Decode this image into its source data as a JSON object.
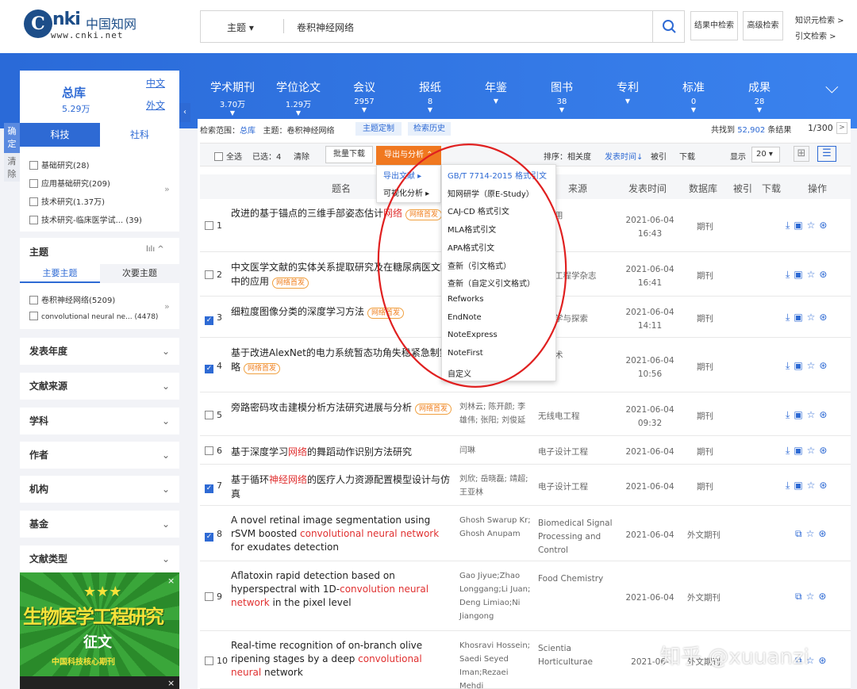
{
  "header": {
    "logo_c": "C",
    "logo_text": "nki",
    "logo_cn": "中国知网",
    "logo_url": "www.cnki.net",
    "search_field": "主题",
    "search_value": "卷积神经网络",
    "btn_result_search": "结果中检索",
    "btn_advanced": "高级检索",
    "link_knowledge": "知识元检索 >",
    "link_citation": "引文检索 >"
  },
  "databases": [
    {
      "name": "学术期刊",
      "count": "3.70万"
    },
    {
      "name": "学位论文",
      "count": "1.29万"
    },
    {
      "name": "会议",
      "count": "2957"
    },
    {
      "name": "报纸",
      "count": "8"
    },
    {
      "name": "年鉴",
      "count": ""
    },
    {
      "name": "图书",
      "count": "38"
    },
    {
      "name": "专利",
      "count": ""
    },
    {
      "name": "标准",
      "count": "0"
    },
    {
      "name": "成果",
      "count": "28"
    }
  ],
  "zongku": {
    "title": "总库",
    "count": "5.29万",
    "zh": "中文",
    "wai": "外文"
  },
  "side_tabs": {
    "queding": "确定",
    "qingchu": "清除"
  },
  "subject_tabs": {
    "ke": "科技",
    "she": "社科"
  },
  "categories": [
    "基础研究(28)",
    "应用基础研究(209)",
    "技术研究(1.37万)",
    "技术研究-临床医学试... (39)"
  ],
  "topic": {
    "title": "主题",
    "main": "主要主题",
    "secondary": "次要主题",
    "items": [
      "卷积神经网络(5209)",
      "convolutional neural ne... (4478)"
    ]
  },
  "facets": [
    "发表年度",
    "文献来源",
    "学科",
    "作者",
    "机构",
    "基金",
    "文献类型"
  ],
  "scope": {
    "label": "检索范围：",
    "lib": "总库",
    "topic": "主题：卷积神经网络",
    "custom": "主题定制",
    "history": "检索历史",
    "found_prefix": "共找到",
    "found": "52,902",
    "found_suffix": "条结果",
    "page": "1/300"
  },
  "toolbar": {
    "select_all": "全选",
    "selected": "已选：4",
    "clear": "清除",
    "batch_download": "批量下载",
    "export": "导出与分析",
    "sort_label": "排序：相关度",
    "sort_time": "发表时间",
    "sort_cite": "被引",
    "sort_dl": "下载",
    "show_label": "显示",
    "show_val": "20"
  },
  "submenu": {
    "export_doc": "导出文献",
    "visual": "可视化分析"
  },
  "export_menu": [
    "GB/T 7714-2015 格式引文",
    "知网研学（原E-Study）",
    "CAJ-CD 格式引文",
    "MLA格式引文",
    "APA格式引文",
    "查新（引文格式）",
    "查新（自定义引文格式）",
    "Refworks",
    "EndNote",
    "NoteExpress",
    "NoteFirst",
    "自定义"
  ],
  "columns": {
    "title": "题名",
    "source": "来源",
    "date": "发表时间",
    "db": "数据库",
    "cite": "被引",
    "dl": "下载",
    "op": "操作"
  },
  "rows": [
    {
      "n": "1",
      "t1": "改进的基于锚点的三维手部姿态估计",
      "hl": "网络",
      "t2": "",
      "author": "",
      "source": "机应用",
      "date": "2021-06-04",
      "time": "16:43",
      "db": "期刊",
      "checked": false
    },
    {
      "n": "2",
      "t1": "中文医学文献的实体关系提取研究及在糖尿病医",
      "hl": "",
      "t2": "文献中的应用",
      "author": "",
      "source": "医学工程学杂志",
      "date": "2021-06-04",
      "time": "16:41",
      "db": "期刊",
      "checked": false
    },
    {
      "n": "3",
      "t1": "细粒度图像分类的深度学习方法",
      "hl": "",
      "t2": "",
      "author": "",
      "source": "机科学与探索",
      "date": "2021-06-04",
      "time": "14:11",
      "db": "期刊",
      "checked": true
    },
    {
      "n": "4",
      "t1": "基于改进AlexNet的电力系统暂态功角失稳紧急",
      "hl": "",
      "t2": "制策略",
      "author": "",
      "source": "压技术",
      "date": "2021-06-04",
      "time": "10:56",
      "db": "期刊",
      "checked": true
    },
    {
      "n": "5",
      "t1": "旁路密码攻击建模分析方法研究进展与分析",
      "hl": "",
      "t2": "",
      "author": "刘林云; 陈开颜; 李雄伟; 张阳; 刘俊延",
      "source": "无线电工程",
      "date": "2021-06-04",
      "time": "09:32",
      "db": "期刊",
      "checked": false
    },
    {
      "n": "6",
      "t1": "基于深度学习",
      "hl": "网络",
      "t2": "的舞蹈动作识别方法研究",
      "author": "闫琳",
      "source": "电子设计工程",
      "date": "2021-06-04",
      "time": "",
      "db": "期刊",
      "checked": false
    },
    {
      "n": "7",
      "t1": "基于循环",
      "hl": "神经网络",
      "t2": "的医疗人力资源配置模型设计与仿真",
      "author": "刘欣; 岳晓磊; 靖超; 王亚林",
      "source": "电子设计工程",
      "date": "2021-06-04",
      "time": "",
      "db": "期刊",
      "checked": true
    },
    {
      "n": "8",
      "t1": "A novel retinal image segmentation using rSVM boosted ",
      "hl": "convolutional neural network",
      "t2": " for exudates detection",
      "author": "Ghosh Swarup Kr; Ghosh Anupam",
      "source": "Biomedical Signal Processing and Control",
      "date": "2021-06-04",
      "time": "",
      "db": "外文期刊",
      "checked": true
    },
    {
      "n": "9",
      "t1": "Aflatoxin rapid detection based on hyperspectral with 1D-",
      "hl": "convolution neural network",
      "t2": " in the pixel level",
      "author": "Gao Jiyue;Zhao Longgang;Li Juan; Deng Limiao;Ni Jiangong",
      "source": "Food Chemistry",
      "date": "2021-06-04",
      "time": "",
      "db": "外文期刊",
      "checked": false
    },
    {
      "n": "10",
      "t1": "Real-time recognition of on-branch olive ripening stages by a deep ",
      "hl": "convolutional neural",
      "t2": " network",
      "author": "Khosravi Hossein; Saedi Seyed Iman;Rezaei Mehdi",
      "source": "Scientia Horticulturae",
      "date": "2021-06-",
      "time": "",
      "db": "外文期刊",
      "checked": false
    }
  ],
  "badge": "网络首发",
  "ad": {
    "title": "生物医学工程研究",
    "sub": "征文",
    "foot": "中国科技核心期刊"
  },
  "watermark": "知乎 @xuuanzi",
  "colors": {
    "blue": "#2e6ad4",
    "orange": "#f07820",
    "red": "#e03030"
  }
}
